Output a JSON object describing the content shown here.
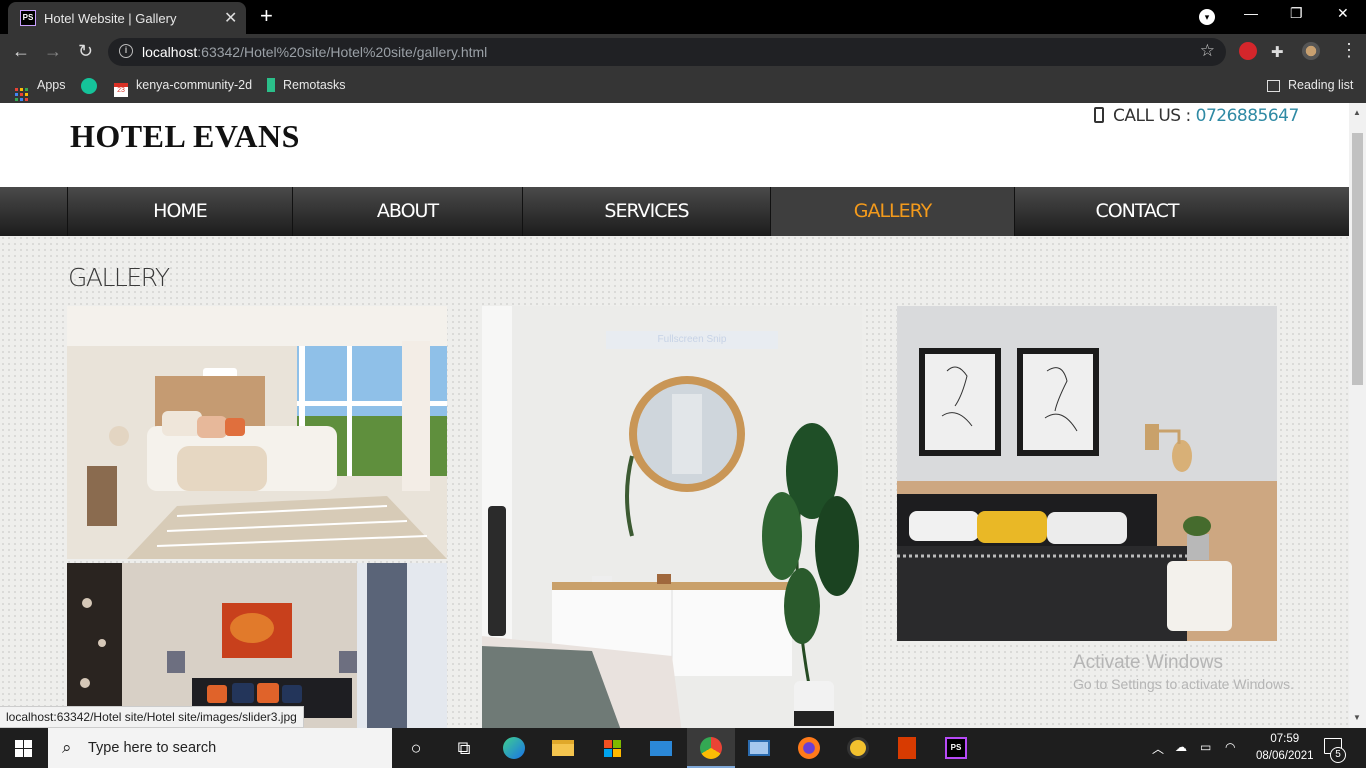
{
  "browser": {
    "tab_title": "Hotel Website | Gallery",
    "url_host": "localhost",
    "url_path": ":63342/Hotel%20site/Hotel%20site/gallery.html",
    "bookmarks": [
      {
        "label": "Apps"
      },
      {
        "label": "kenya-community-2d",
        "badge": "23"
      },
      {
        "label": "Remotasks"
      }
    ],
    "reading_list": "Reading list",
    "status_url": "localhost:63342/Hotel site/Hotel site/images/slider3.jpg"
  },
  "site": {
    "logo": "HOTEL EVANS",
    "call_label": "CALL US : ",
    "phone": "0726885647",
    "nav": [
      {
        "label": "HOME"
      },
      {
        "label": "ABOUT"
      },
      {
        "label": "SERVICES"
      },
      {
        "label": "GALLERY",
        "active": true
      },
      {
        "label": "CONTACT"
      }
    ],
    "nav_active_color": "#f39a1c",
    "phone_color": "#2f8aa4",
    "section_title": "GALLERY",
    "snip_hint": "Fullscreen Snip"
  },
  "watermark": {
    "line1": "Activate Windows",
    "line2": "Go to Settings to activate Windows."
  },
  "taskbar": {
    "search_placeholder": "Type here to search",
    "time": "07:59",
    "date": "08/06/2021",
    "notification_count": "5"
  }
}
